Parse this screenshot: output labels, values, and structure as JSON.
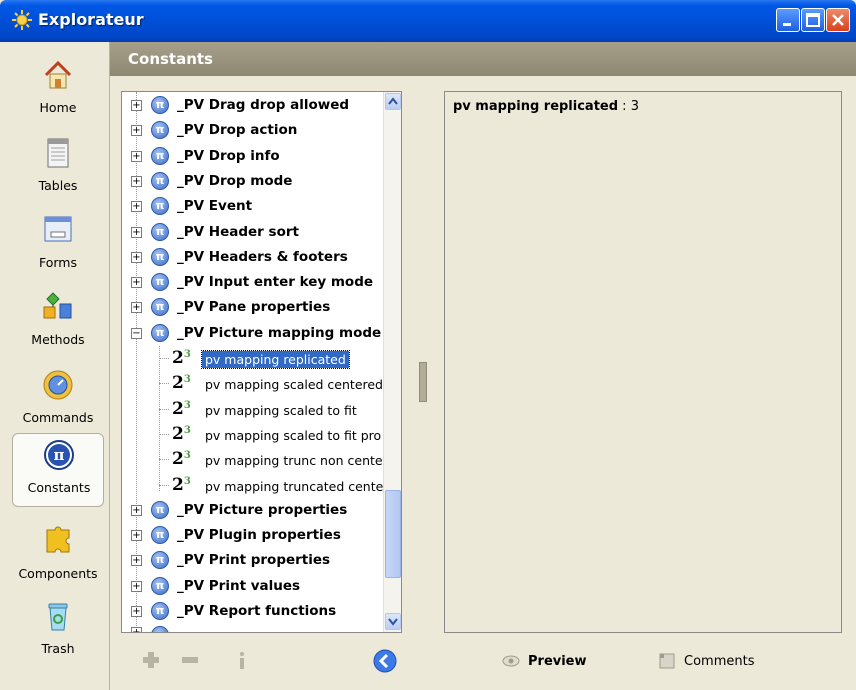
{
  "window": {
    "title": "Explorateur"
  },
  "header": {
    "title": "Constants"
  },
  "sidebar": {
    "items": [
      {
        "label": "Home",
        "icon": "home-icon"
      },
      {
        "label": "Tables",
        "icon": "tables-icon"
      },
      {
        "label": "Forms",
        "icon": "forms-icon"
      },
      {
        "label": "Methods",
        "icon": "methods-icon"
      },
      {
        "label": "Commands",
        "icon": "commands-icon"
      },
      {
        "label": "Constants",
        "icon": "constants-icon",
        "active": true
      },
      {
        "label": "Components",
        "icon": "components-icon"
      },
      {
        "label": "Trash",
        "icon": "trash-icon"
      }
    ]
  },
  "tree": {
    "groups_before": [
      "_PV Drag drop allowed",
      "_PV Drop action",
      "_PV Drop info",
      "_PV Drop mode",
      "_PV Event",
      "_PV Header sort",
      "_PV Headers & footers",
      "_PV Input enter key mode",
      "_PV Pane properties"
    ],
    "expanded_group": "_PV Picture mapping mode",
    "children": [
      "pv mapping replicated",
      "pv mapping scaled centered",
      "pv mapping scaled to fit",
      "pv mapping scaled to fit pro",
      "pv mapping trunc non cente",
      "pv mapping truncated cente"
    ],
    "selected_child": 0,
    "groups_after": [
      "_PV Picture properties",
      "_PV Plugin properties",
      "_PV Print properties",
      "_PV Print values",
      "_PV Report functions"
    ],
    "expand_glyph": "+",
    "collapse_glyph": "−",
    "pi_glyph": "π",
    "number_glyph": "2",
    "number_glyph_small": "3"
  },
  "detail": {
    "name": "pv mapping replicated",
    "separator": " : ",
    "value": "3"
  },
  "toolbar": {
    "preview_label": "Preview",
    "comments_label": "Comments"
  }
}
